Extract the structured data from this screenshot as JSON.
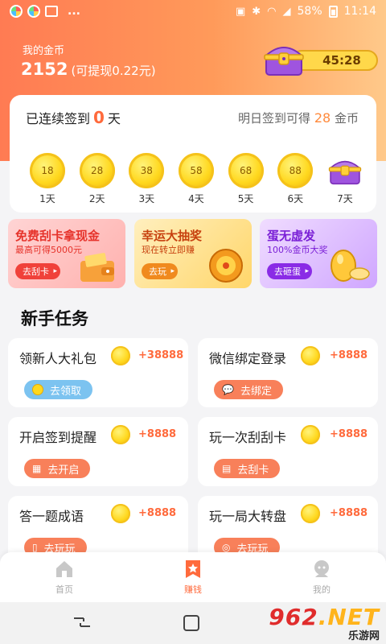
{
  "status_bar": {
    "battery": "58%",
    "time": "11:14",
    "overflow": "..."
  },
  "header": {
    "coin_label": "我的金币",
    "coin_amount": "2152",
    "coin_cash": "(可提现0.22元)",
    "chest_timer": "45:28"
  },
  "sign_in": {
    "streak_prefix": "已连续签到",
    "streak_days": "0",
    "streak_suffix": "天",
    "tomorrow_prefix": "明日签到可得",
    "tomorrow_amount": "28",
    "tomorrow_suffix": "金币",
    "days": [
      {
        "coins": "18",
        "label": "1天"
      },
      {
        "coins": "28",
        "label": "2天"
      },
      {
        "coins": "38",
        "label": "3天"
      },
      {
        "coins": "58",
        "label": "4天"
      },
      {
        "coins": "68",
        "label": "5天"
      },
      {
        "coins": "88",
        "label": "6天"
      },
      {
        "coins": "",
        "label": "7天"
      }
    ]
  },
  "promos": [
    {
      "title": "免费刮卡拿现金",
      "subtitle": "最高可得5000元",
      "button": "去刮卡"
    },
    {
      "title": "幸运大抽奖",
      "subtitle": "现在转立即赚",
      "button": "去玩"
    },
    {
      "title": "蛋无虚发",
      "subtitle": "100%金币大奖",
      "button": "去砸蛋"
    }
  ],
  "section_title": "新手任务",
  "tasks": [
    {
      "name": "领新人大礼包",
      "reward": "+38888",
      "button": "去领取",
      "icon": "coin-icon"
    },
    {
      "name": "微信绑定登录",
      "reward": "+8888",
      "button": "去绑定",
      "icon": "wechat-icon"
    },
    {
      "name": "开启签到提醒",
      "reward": "+8888",
      "button": "去开启",
      "icon": "calendar-icon"
    },
    {
      "name": "玩一次刮刮卡",
      "reward": "+8888",
      "button": "去刮卡",
      "icon": "scratch-icon"
    },
    {
      "name": "答一题成语",
      "reward": "+8888",
      "button": "去玩玩",
      "icon": "book-icon"
    },
    {
      "name": "玩一局大转盘",
      "reward": "+8888",
      "button": "去玩玩",
      "icon": "wheel-icon"
    }
  ],
  "bottom_nav": [
    {
      "label": "首页",
      "icon": "home-icon"
    },
    {
      "label": "赚钱",
      "icon": "earn-icon"
    },
    {
      "label": "我的",
      "icon": "profile-icon"
    }
  ],
  "watermark": {
    "logo_num": "962",
    "logo_net": ".NET",
    "sub": "乐游网"
  },
  "colors": {
    "accent": "#ff6a3c",
    "header_start": "#ff7b53",
    "header_end": "#ffc98a",
    "coin_gold": "#ffd81e"
  }
}
